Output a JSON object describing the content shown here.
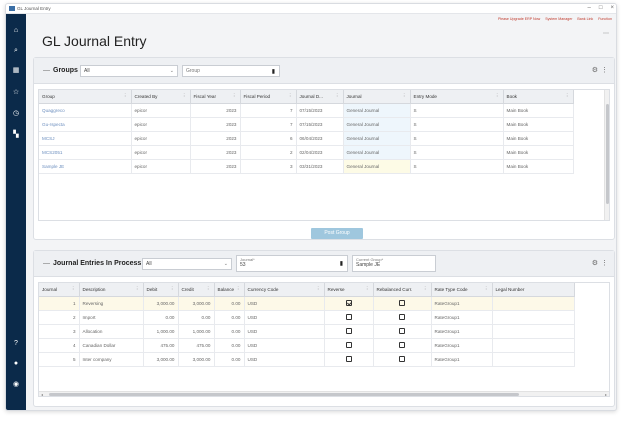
{
  "window": {
    "title": "GL Journal Entry"
  },
  "top_links": [
    "Please Upgrade ERP Now",
    "System Manager",
    "Bank Link",
    "Function"
  ],
  "page_title": "GL Journal Entry",
  "groups": {
    "label": "Groups",
    "selected": "All",
    "filter_placeholder": "Group",
    "columns": [
      "Group",
      "Created By",
      "Fiscal Year",
      "Fiscal Period",
      "Journal D...",
      "Journal",
      "Entry Mode",
      "Book"
    ],
    "rows": [
      [
        "Quaggreco",
        "epicor",
        "2023",
        "7",
        "07/15/2023",
        "General Journal",
        "S",
        "Main Book"
      ],
      [
        "Gu-rspecta",
        "epicor",
        "2023",
        "7",
        "07/15/2023",
        "General Journal",
        "S",
        "Main Book"
      ],
      [
        "MCSJ",
        "epicor",
        "2023",
        "6",
        "06/04/2023",
        "General Journal",
        "S",
        "Main Book"
      ],
      [
        "MCS2051",
        "epicor",
        "2023",
        "2",
        "02/04/2023",
        "General Journal",
        "S",
        "Main Book"
      ],
      [
        "Sample JE",
        "epicor",
        "2023",
        "3",
        "03/31/2023",
        "General Journal",
        "S",
        "Main Book"
      ]
    ],
    "post_button": "Post Group"
  },
  "entries": {
    "label": "Journal Entries In Process",
    "selected": "All",
    "filter1_label": "Journal*",
    "filter1_value": "53",
    "filter2_label": "Current Group*",
    "filter2_value": "Sample JE",
    "columns": [
      "Journal",
      "Description",
      "Debit",
      "Credit",
      "Balance",
      "Currency Code",
      "Reverse",
      "Rebalanced Curr.",
      "Rate Type Code",
      "Legal Number"
    ],
    "rows": [
      {
        "journal": "1",
        "desc": "Reversing",
        "debit": "3,000.00",
        "credit": "3,000.00",
        "balance": "0.00",
        "currency": "USD",
        "reverse": true,
        "rebal": false,
        "rate": "RateGroup1",
        "legal": ""
      },
      {
        "journal": "2",
        "desc": "Import",
        "debit": "0.00",
        "credit": "0.00",
        "balance": "0.00",
        "currency": "USD",
        "reverse": false,
        "rebal": false,
        "rate": "RateGroup1",
        "legal": ""
      },
      {
        "journal": "3",
        "desc": "Allocation",
        "debit": "1,000.00",
        "credit": "1,000.00",
        "balance": "0.00",
        "currency": "USD",
        "reverse": false,
        "rebal": false,
        "rate": "RateGroup1",
        "legal": ""
      },
      {
        "journal": "4",
        "desc": "Canadian Dollar",
        "debit": "475.00",
        "credit": "475.00",
        "balance": "0.00",
        "currency": "USD",
        "reverse": false,
        "rebal": false,
        "rate": "RateGroup1",
        "legal": ""
      },
      {
        "journal": "5",
        "desc": "Inter company",
        "debit": "3,000.00",
        "credit": "3,000.00",
        "balance": "0.00",
        "currency": "USD",
        "reverse": false,
        "rebal": false,
        "rate": "RateGroup1",
        "legal": ""
      }
    ]
  }
}
